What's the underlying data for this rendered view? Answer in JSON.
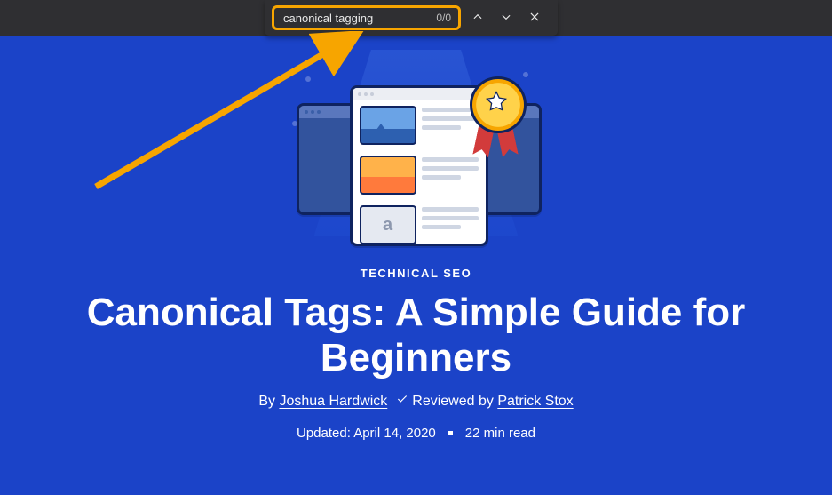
{
  "find": {
    "query": "canonical tagging",
    "count": "0/0"
  },
  "kicker": "TECHNICAL SEO",
  "title": "Canonical Tags: A Simple Guide for Beginners",
  "byline": {
    "by_prefix": "By ",
    "author": "Joshua Hardwick",
    "reviewed_prefix": "Reviewed by ",
    "reviewer": "Patrick Stox"
  },
  "meta": {
    "updated": "Updated: April 14, 2020",
    "read_time": "22 min read"
  }
}
